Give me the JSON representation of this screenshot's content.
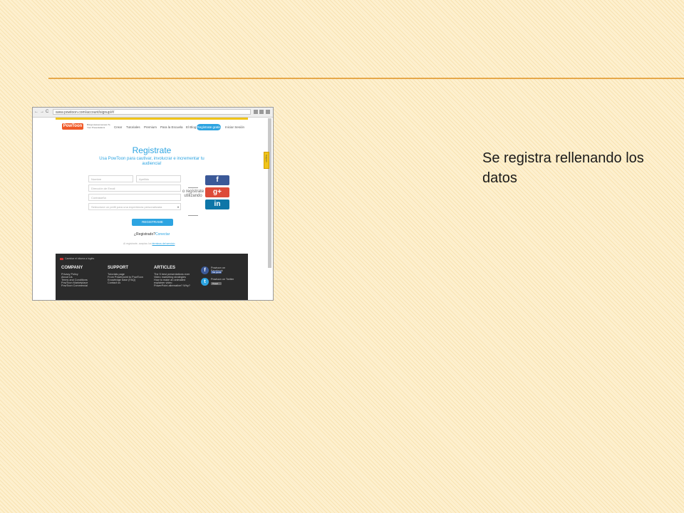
{
  "slide": {
    "caption": "Se registra rellenando los datos"
  },
  "browser": {
    "back": "←",
    "forward": "→",
    "reload": "C",
    "url": "www.powtoon.com/account/signup/#/"
  },
  "powtoon": {
    "header": {
      "logo": "PowToon",
      "tagline": "Brings Awesomeness To Your Presentations",
      "menu": [
        "Crear",
        "Tutoriales",
        "Premium",
        "Para la Escuela",
        "El Blog"
      ],
      "register_button": "Regístrate gratis",
      "login": "Iniciar Sesión"
    },
    "form": {
      "title": "Registrate",
      "subtitle": "Usa PowToon para cautivar, involucrar e incrementar tu audiencia!",
      "first_name": "Nombre",
      "last_name": "Apellido",
      "email": "Dirección de Email",
      "password": "Contraseña",
      "profile": "Seleccione un perfil para una experiencia personalizada",
      "or_text": "o regístrate utilizando",
      "submit": "REGISTRAME",
      "already_registered": "¿Registrado?",
      "connect": "Conectar",
      "terms_prefix": "Al registrarte, aceptas los",
      "terms_link": "términos del servicio"
    },
    "social": {
      "facebook": "f",
      "google": "g+",
      "linkedin": "in"
    },
    "footer": {
      "language": "Cambiar el idioma a inglés",
      "company": {
        "heading": "COMPANY",
        "items": [
          "Privacy Policy",
          "About Us",
          "Terms and Conditions",
          "PowToon Marketplace",
          "PowToon Commercial"
        ]
      },
      "support": {
        "heading": "SUPPORT",
        "items": [
          "Tutorials page",
          "From Powerpoint to PowToon",
          "Knowledge base (FAQ)",
          "Contact us"
        ]
      },
      "articles": {
        "heading": "ARTICLES",
        "items": [
          "The 5 best presentations ever",
          "Video marketing strategies",
          "How to make an animated explainer video",
          "PowerPoint alternative? Why?"
        ]
      },
      "facebook_label": "Powtoon on Facebook",
      "twitter_label": "Powtoon on Twitter",
      "like_button": "Me gusta",
      "follow_button": "Tweet"
    },
    "feedback_tab": "Support"
  },
  "colors": {
    "accent": "#2da4e1",
    "logo": "#f05a28",
    "facebook": "#3b5998",
    "google": "#dd4b39",
    "linkedin": "#0e76a8",
    "rule": "#e6a84a"
  }
}
